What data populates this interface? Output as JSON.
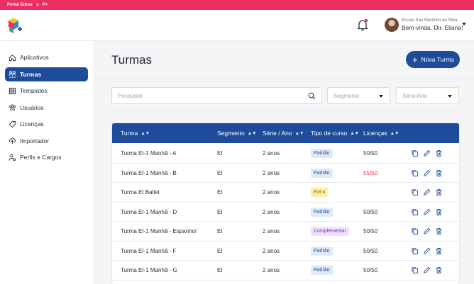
{
  "topbar": {
    "portal": "Portal Edros",
    "separator": ">",
    "section": "P+"
  },
  "header": {
    "school": "Escola São Martinho da Silva",
    "greeting": "Bem-vinda, Dir. Eliana!"
  },
  "sidebar": {
    "items": [
      {
        "label": "Aplicativos",
        "icon": "home-icon",
        "active": false
      },
      {
        "label": "Turmas",
        "icon": "users-group-icon",
        "active": true
      },
      {
        "label": "Templates",
        "icon": "grid-icon",
        "active": false
      },
      {
        "label": "Usuários",
        "icon": "users-icon",
        "active": false
      },
      {
        "label": "Licenças",
        "icon": "tag-icon",
        "active": false
      },
      {
        "label": "Importador",
        "icon": "cloud-upload-icon",
        "active": false
      },
      {
        "label": "Perfis e Cargos",
        "icon": "user-settings-icon",
        "active": false
      }
    ]
  },
  "main": {
    "title": "Turmas",
    "new_button": "Nova Turma",
    "search_placeholder": "Pesquisar",
    "filter_segment": "Segmento",
    "filter_serie": "Série/Ano"
  },
  "table": {
    "headers": {
      "turma": "Turma",
      "segmento": "Segmento",
      "serie": "Série / Ano",
      "tipo": "Tipo de curso",
      "licencas": "Licenças"
    },
    "rows": [
      {
        "turma": "Turma  EI-1 Manhã - A",
        "segmento": "EI",
        "serie": "2 anos",
        "tipo": "Padrão",
        "licencas": "50/50"
      },
      {
        "turma": "Turma  EI-1 Manhã - B",
        "segmento": "EI",
        "serie": "2 anos",
        "tipo": "Padrão",
        "licencas": "55/50"
      },
      {
        "turma": "Turma  EI Ballet",
        "segmento": "EI",
        "serie": "2 anos",
        "tipo": "Extra",
        "licencas": ""
      },
      {
        "turma": "Turma  EI-1 Manhã - D",
        "segmento": "EI",
        "serie": "2 anos",
        "tipo": "Padrão",
        "licencas": "50/50"
      },
      {
        "turma": "Turma  EI-1 Manhã - Espanhol",
        "segmento": "EI",
        "serie": "2 anos",
        "tipo": "Complementar",
        "licencas": "50/50"
      },
      {
        "turma": "Turma  EI-1 Manhã - F",
        "segmento": "EI",
        "serie": "2 anos",
        "tipo": "Padrão",
        "licencas": "50/50"
      },
      {
        "turma": "Turma  EI-1 Manhã - G",
        "segmento": "EI",
        "serie": "2 anos",
        "tipo": "Padrão",
        "licencas": "50/50"
      }
    ]
  },
  "colors": {
    "topbar": "#ec2f63",
    "primary": "#1f4c9a",
    "over_limit": "#e8344a"
  }
}
